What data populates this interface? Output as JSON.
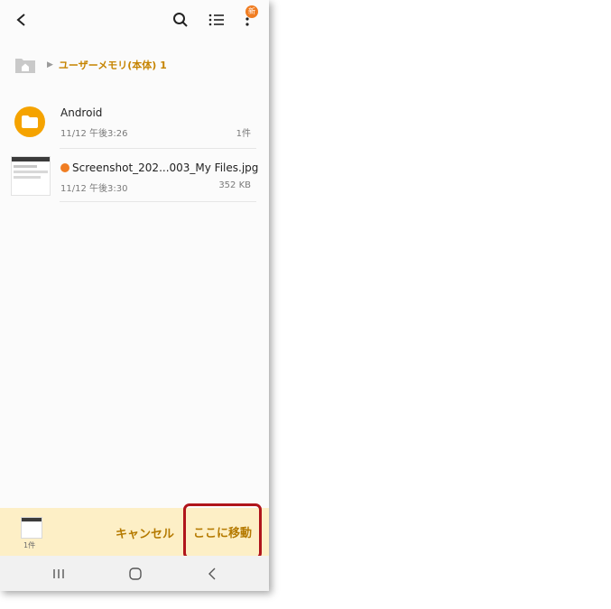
{
  "appbar": {
    "back_icon": "chevron-left-icon",
    "search_icon": "search-icon",
    "list_icon": "list-view-icon",
    "more_icon": "more-vertical-icon",
    "badge": "新"
  },
  "breadcrumb": {
    "home_icon": "home-folder-icon",
    "path": "ユーザーメモリ(本体) 1"
  },
  "files": [
    {
      "name": "Android",
      "date": "11/12 午後3:26",
      "size": "1件",
      "icon": "folder-icon"
    },
    {
      "name": "Screenshot_202...003_My Files.jpg",
      "date": "11/12 午後3:30",
      "size": "352 KB",
      "icon": "image-thumbnail"
    }
  ],
  "bottom": {
    "selected_count": "1件",
    "cancel_label": "キャンセル",
    "move_label": "ここに移動"
  },
  "colors": {
    "accent": "#c68400",
    "folder": "#f5a300",
    "badge": "#f07d22",
    "bottom_bar": "#fdefc6",
    "highlight_border": "#b0151b"
  }
}
